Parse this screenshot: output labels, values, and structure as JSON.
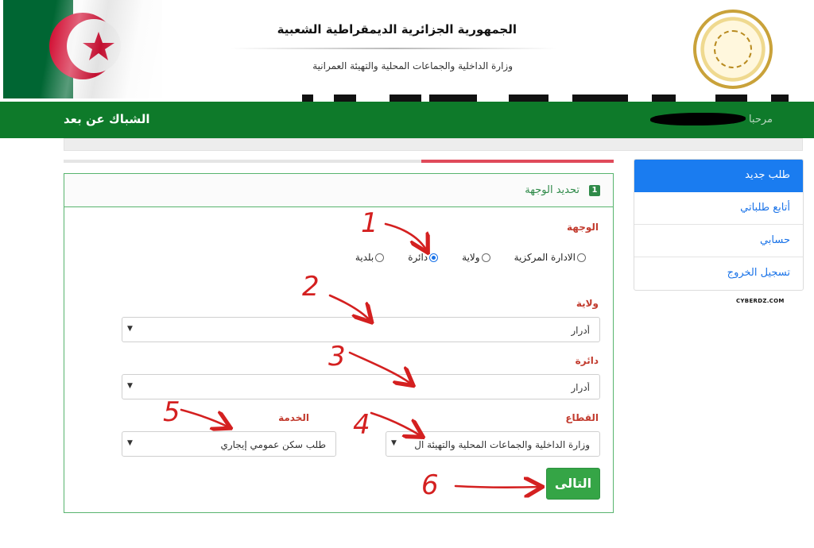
{
  "header": {
    "title": "الجمهورية الجزائرية الديمقراطية الشعبية",
    "subtitle": "وزارة الداخلية والجماعات المحلية والتهيئة العمرانية"
  },
  "navbar": {
    "brand": "الشباك عن بعد",
    "greeting": "مرحبا"
  },
  "progress": {
    "value_percent": 35
  },
  "card": {
    "step_number": "1",
    "title": "تحديد الوجهة",
    "destination": {
      "label": "الوجهة",
      "options": [
        "الادارة المركزية",
        "ولاية",
        "دائرة",
        "بلدية"
      ],
      "selected": "دائرة"
    },
    "wilaya": {
      "label": "ولاية",
      "value": "أدرار"
    },
    "daira": {
      "label": "دائرة",
      "value": "أدرار"
    },
    "sector": {
      "label": "القطاع",
      "value": "وزارة الداخلية والجماعات المحلية والتهيئة ال"
    },
    "service": {
      "label": "الخدمة",
      "value": "طلب سكن عمومي إيجاري"
    },
    "next_label": "التالى"
  },
  "sidebar": {
    "items": [
      {
        "label": "طلب جديد",
        "active": true
      },
      {
        "label": "أتابع طلباتي",
        "active": false
      },
      {
        "label": "حسابي",
        "active": false
      },
      {
        "label": "تسجيل الخروج",
        "active": false
      }
    ]
  },
  "watermark": "CYBERDZ.COM",
  "annotations": [
    "1",
    "2",
    "3",
    "4",
    "5",
    "6"
  ],
  "colors": {
    "green_bar": "#0e7a2a",
    "card_border": "#58b46e",
    "label_red": "#c23b2e",
    "primary_blue": "#1a7cf0",
    "button_green": "#35a546",
    "annotation_red": "#d42020"
  }
}
